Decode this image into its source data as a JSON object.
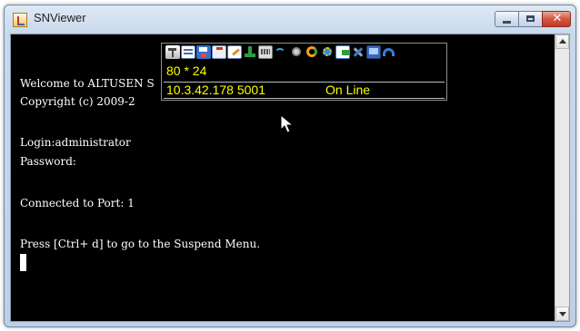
{
  "window": {
    "title": "SNViewer"
  },
  "terminal": {
    "lines": [
      "Welcome to ALTUSEN S",
      "Copyright (c) 2009-2",
      "",
      "Login:administrator",
      "Password:",
      "",
      "Connected to Port: 1",
      "",
      "Press [Ctrl+ d] to go to the Suspend Menu."
    ]
  },
  "overlay": {
    "size_text": "80 * 24",
    "address_text": "10.3.42.178 5001",
    "status_text": "On Line",
    "text_color": "#ffff00"
  },
  "toolbar": {
    "icons": [
      "pin-icon",
      "document-icon",
      "save-icon",
      "clipboard-icon",
      "edit-icon",
      "download-icon",
      "keyboard-icon",
      "wifi-icon",
      "circle-icon",
      "refresh-icon",
      "gear-icon",
      "export-icon",
      "tools-icon",
      "monitor-icon",
      "undo-icon"
    ]
  },
  "colors": {
    "terminal_bg": "#000000",
    "terminal_text": "#ffffff",
    "close_button": "#c0392b"
  }
}
